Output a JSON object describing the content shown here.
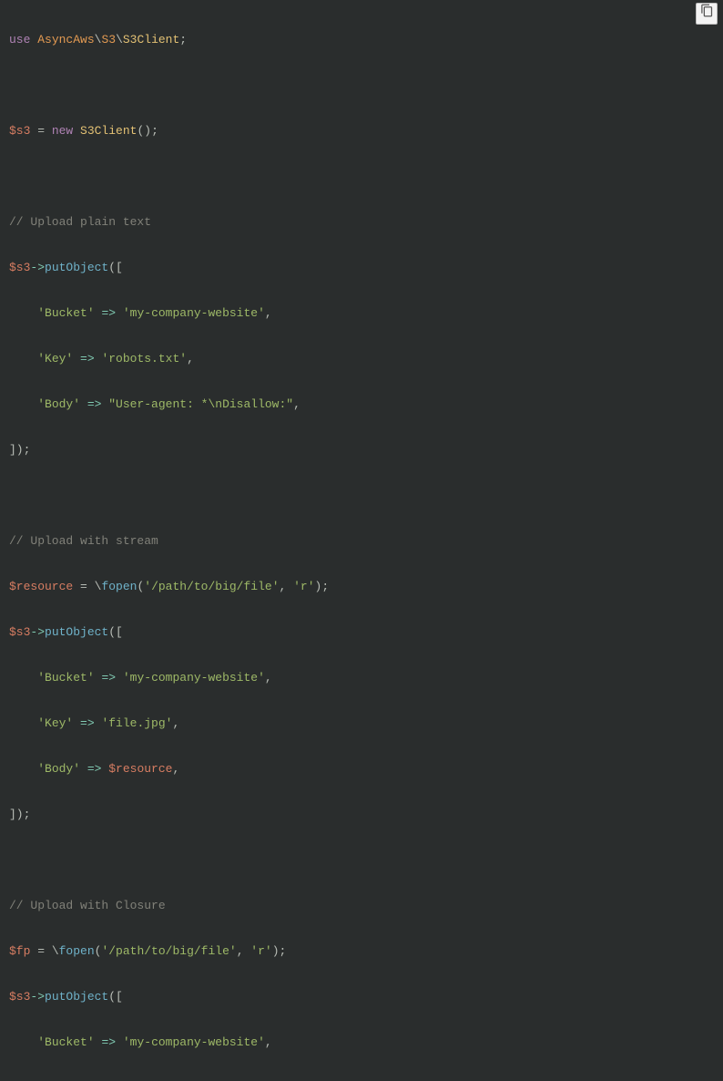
{
  "icon": {
    "copy": "copy-icon"
  },
  "code": {
    "l1": {
      "kw_use": "use",
      "ns1": "AsyncAws",
      "bs1": "\\",
      "ns2": "S3",
      "bs2": "\\",
      "cls": "S3Client",
      "semi": ";"
    },
    "l2": {
      "var": "$s3",
      "eq": " = ",
      "kw_new": "new",
      "sp": " ",
      "cls": "S3Client",
      "paren": "()",
      "semi": ";"
    },
    "c1": "// Upload plain text",
    "l3": {
      "var": "$s3",
      "arrow": "->",
      "method": "putObject",
      "open": "(["
    },
    "l4": {
      "pad": "    ",
      "k": "'Bucket'",
      "fat": " => ",
      "v": "'my-company-website'",
      "comma": ","
    },
    "l5": {
      "pad": "    ",
      "k": "'Key'",
      "fat": " => ",
      "v": "'robots.txt'",
      "comma": ","
    },
    "l6": {
      "pad": "    ",
      "k": "'Body'",
      "fat": " => ",
      "v": "\"User-agent: *\\nDisallow:\"",
      "comma": ","
    },
    "l7": {
      "close": "]);",
      "text": "])",
      "semi": ";"
    },
    "c2": "// Upload with stream",
    "l8": {
      "var": "$resource",
      "eq": " = ",
      "bs": "\\",
      "fn": "fopen",
      "op": "(",
      "a1": "'/path/to/big/file'",
      "comma": ", ",
      "a2": "'r'",
      "cp": ")",
      "semi": ";"
    },
    "l9": {
      "var": "$s3",
      "arrow": "->",
      "method": "putObject",
      "open": "(["
    },
    "l10": {
      "pad": "    ",
      "k": "'Bucket'",
      "fat": " => ",
      "v": "'my-company-website'",
      "comma": ","
    },
    "l11": {
      "pad": "    ",
      "k": "'Key'",
      "fat": " => ",
      "v": "'file.jpg'",
      "comma": ","
    },
    "l12": {
      "pad": "    ",
      "k": "'Body'",
      "fat": " => ",
      "v": "$resource",
      "comma": ","
    },
    "l13": {
      "close": "])",
      "semi": ";"
    },
    "c3": "// Upload with Closure",
    "l14": {
      "var": "$fp",
      "eq": " = ",
      "bs": "\\",
      "fn": "fopen",
      "op": "(",
      "a1": "'/path/to/big/file'",
      "comma": ", ",
      "a2": "'r'",
      "cp": ")",
      "semi": ";"
    },
    "l15": {
      "var": "$s3",
      "arrow": "->",
      "method": "putObject",
      "open": "(["
    },
    "l16": {
      "pad": "    ",
      "k": "'Bucket'",
      "fat": " => ",
      "v": "'my-company-website'",
      "comma": ","
    }
  }
}
